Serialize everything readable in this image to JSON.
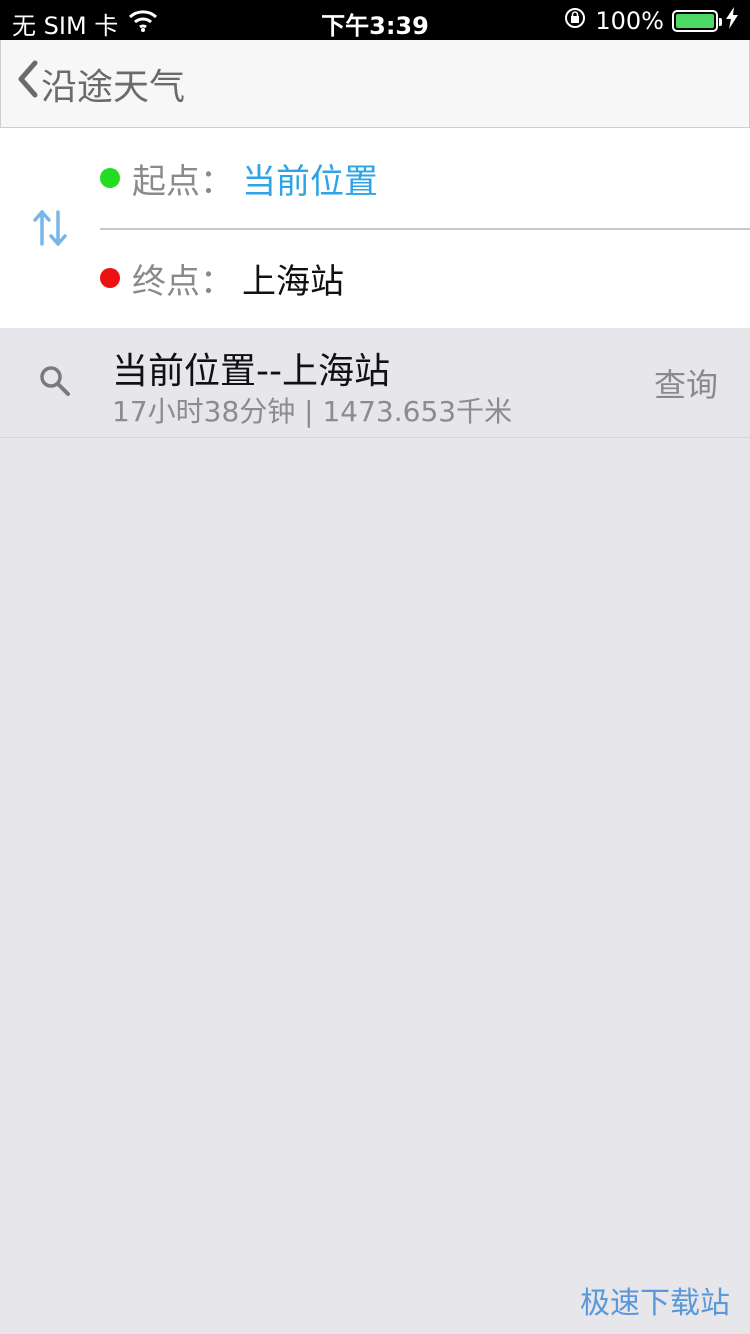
{
  "status_bar": {
    "carrier": "无 SIM 卡",
    "time": "下午3:39",
    "battery_percent": "100%",
    "battery_level": 1.0
  },
  "nav": {
    "title": "沿途天气"
  },
  "route": {
    "start_label": "起点：",
    "start_value": "当前位置",
    "end_label": "终点：",
    "end_value": "上海站",
    "start_dot_color": "#22dd22",
    "end_dot_color": "#ee1111",
    "start_value_color": "#2ea3e6"
  },
  "result": {
    "title": "当前位置--上海站",
    "summary": "17小时38分钟 | 1473.653千米",
    "query_label": "查询"
  },
  "watermark": {
    "text": "极速下载站"
  },
  "icons": {
    "back": "chevron-left-icon",
    "swap": "swap-vertical-icon",
    "search": "search-icon",
    "wifi": "wifi-icon",
    "lock": "orientation-lock-icon",
    "charging": "bolt-icon"
  }
}
